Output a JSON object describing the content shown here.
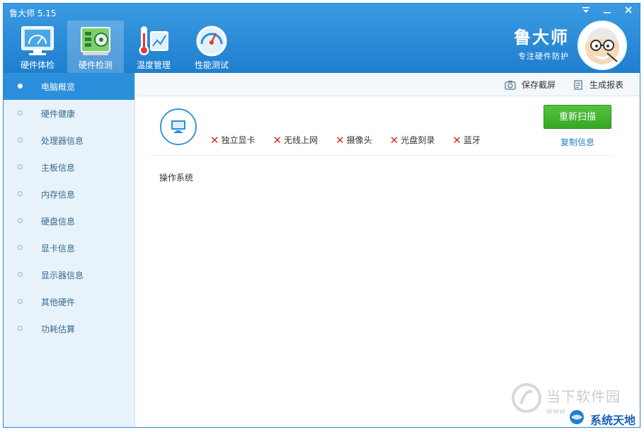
{
  "window": {
    "title": "鲁大师 5.15",
    "controls": [
      "dropdown",
      "minimize",
      "close"
    ]
  },
  "nav": {
    "items": [
      {
        "label": "硬件体检",
        "icon": "monitor-gauge-icon"
      },
      {
        "label": "硬件检测",
        "icon": "circuit-board-icon"
      },
      {
        "label": "温度管理",
        "icon": "thermometer-icon"
      },
      {
        "label": "性能测试",
        "icon": "speedometer-icon"
      }
    ],
    "active_index": 1
  },
  "brand": {
    "name": "鲁大师",
    "slogan": "专注硬件防护"
  },
  "sidebar": {
    "active_index": 0,
    "items": [
      {
        "label": "电脑概览"
      },
      {
        "label": "硬件健康"
      },
      {
        "label": "处理器信息"
      },
      {
        "label": "主板信息"
      },
      {
        "label": "内存信息"
      },
      {
        "label": "硬盘信息"
      },
      {
        "label": "显卡信息"
      },
      {
        "label": "显示器信息"
      },
      {
        "label": "其他硬件"
      },
      {
        "label": "功耗估算"
      }
    ]
  },
  "toolbar": {
    "save_screenshot": "保存截屏",
    "generate_report": "生成报表"
  },
  "overview": {
    "features": [
      {
        "label": "独立显卡",
        "status": "absent"
      },
      {
        "label": "无线上网",
        "status": "absent"
      },
      {
        "label": "摄像头",
        "status": "absent"
      },
      {
        "label": "光盘刻录",
        "status": "absent"
      },
      {
        "label": "蓝牙",
        "status": "absent"
      }
    ],
    "rescan_label": "重新扫描",
    "copy_label": "复制信息",
    "os_label": "操作系统"
  },
  "watermark": {
    "site": "当下软件园",
    "www": "www",
    "sys": "系统天地"
  },
  "colors": {
    "header_blue": "#2b8dd8",
    "sidebar_bg": "#e7f2fa",
    "active_blue": "#2b8fdc",
    "green_button": "#3fb22c",
    "absent_red": "#e02828",
    "link_blue": "#2a7bc4"
  }
}
